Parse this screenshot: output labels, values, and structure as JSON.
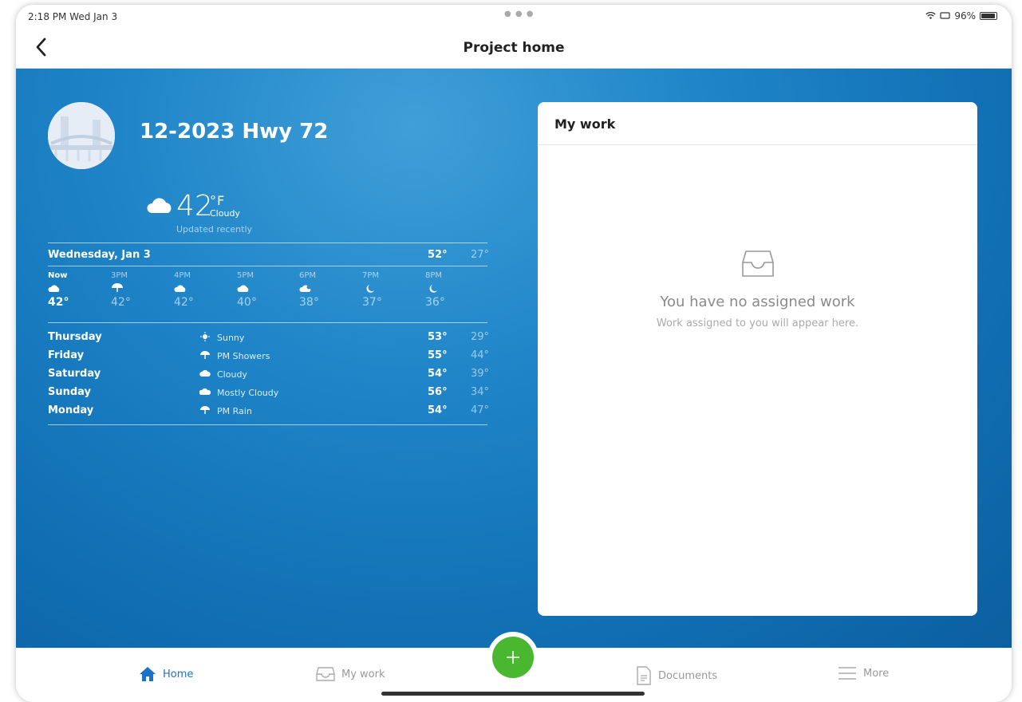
{
  "status_bar": {
    "time": "2:18 PM  Wed Jan 3",
    "battery": "96%"
  },
  "nav": {
    "title": "Project home"
  },
  "project": {
    "name": "12-2023 Hwy 72"
  },
  "current_weather": {
    "temp": "42",
    "unit": "°F",
    "condition": "Cloudy",
    "updated": "Updated recently",
    "icon": "cloud-icon"
  },
  "today": {
    "label": "Wednesday, Jan 3",
    "hi": "52°",
    "lo": "27°"
  },
  "hourly": [
    {
      "label": "Now",
      "temp": "42°",
      "icon": "cloud"
    },
    {
      "label": "3PM",
      "temp": "42°",
      "icon": "rain"
    },
    {
      "label": "4PM",
      "temp": "42°",
      "icon": "cloud"
    },
    {
      "label": "5PM",
      "temp": "40°",
      "icon": "cloud"
    },
    {
      "label": "6PM",
      "temp": "38°",
      "icon": "cloud-moon"
    },
    {
      "label": "7PM",
      "temp": "37°",
      "icon": "moon"
    },
    {
      "label": "8PM",
      "temp": "36°",
      "icon": "moon"
    }
  ],
  "daily": [
    {
      "day": "Thursday",
      "condition": "Sunny",
      "hi": "53°",
      "lo": "29°",
      "icon": "sun"
    },
    {
      "day": "Friday",
      "condition": "PM Showers",
      "hi": "55°",
      "lo": "44°",
      "icon": "rain"
    },
    {
      "day": "Saturday",
      "condition": "Cloudy",
      "hi": "54°",
      "lo": "39°",
      "icon": "cloud"
    },
    {
      "day": "Sunday",
      "condition": "Mostly Cloudy",
      "hi": "56°",
      "lo": "34°",
      "icon": "cloud"
    },
    {
      "day": "Monday",
      "condition": "PM Rain",
      "hi": "54°",
      "lo": "47°",
      "icon": "rain"
    }
  ],
  "my_work": {
    "title": "My work",
    "empty_title": "You have no assigned work",
    "empty_subtitle": "Work assigned to you will appear here."
  },
  "tabs": {
    "home": "Home",
    "my_work": "My work",
    "documents": "Documents",
    "more": "More"
  },
  "colors": {
    "accent": "#1a73c7",
    "fab": "#49b72f",
    "hero": "#1f85c8"
  }
}
